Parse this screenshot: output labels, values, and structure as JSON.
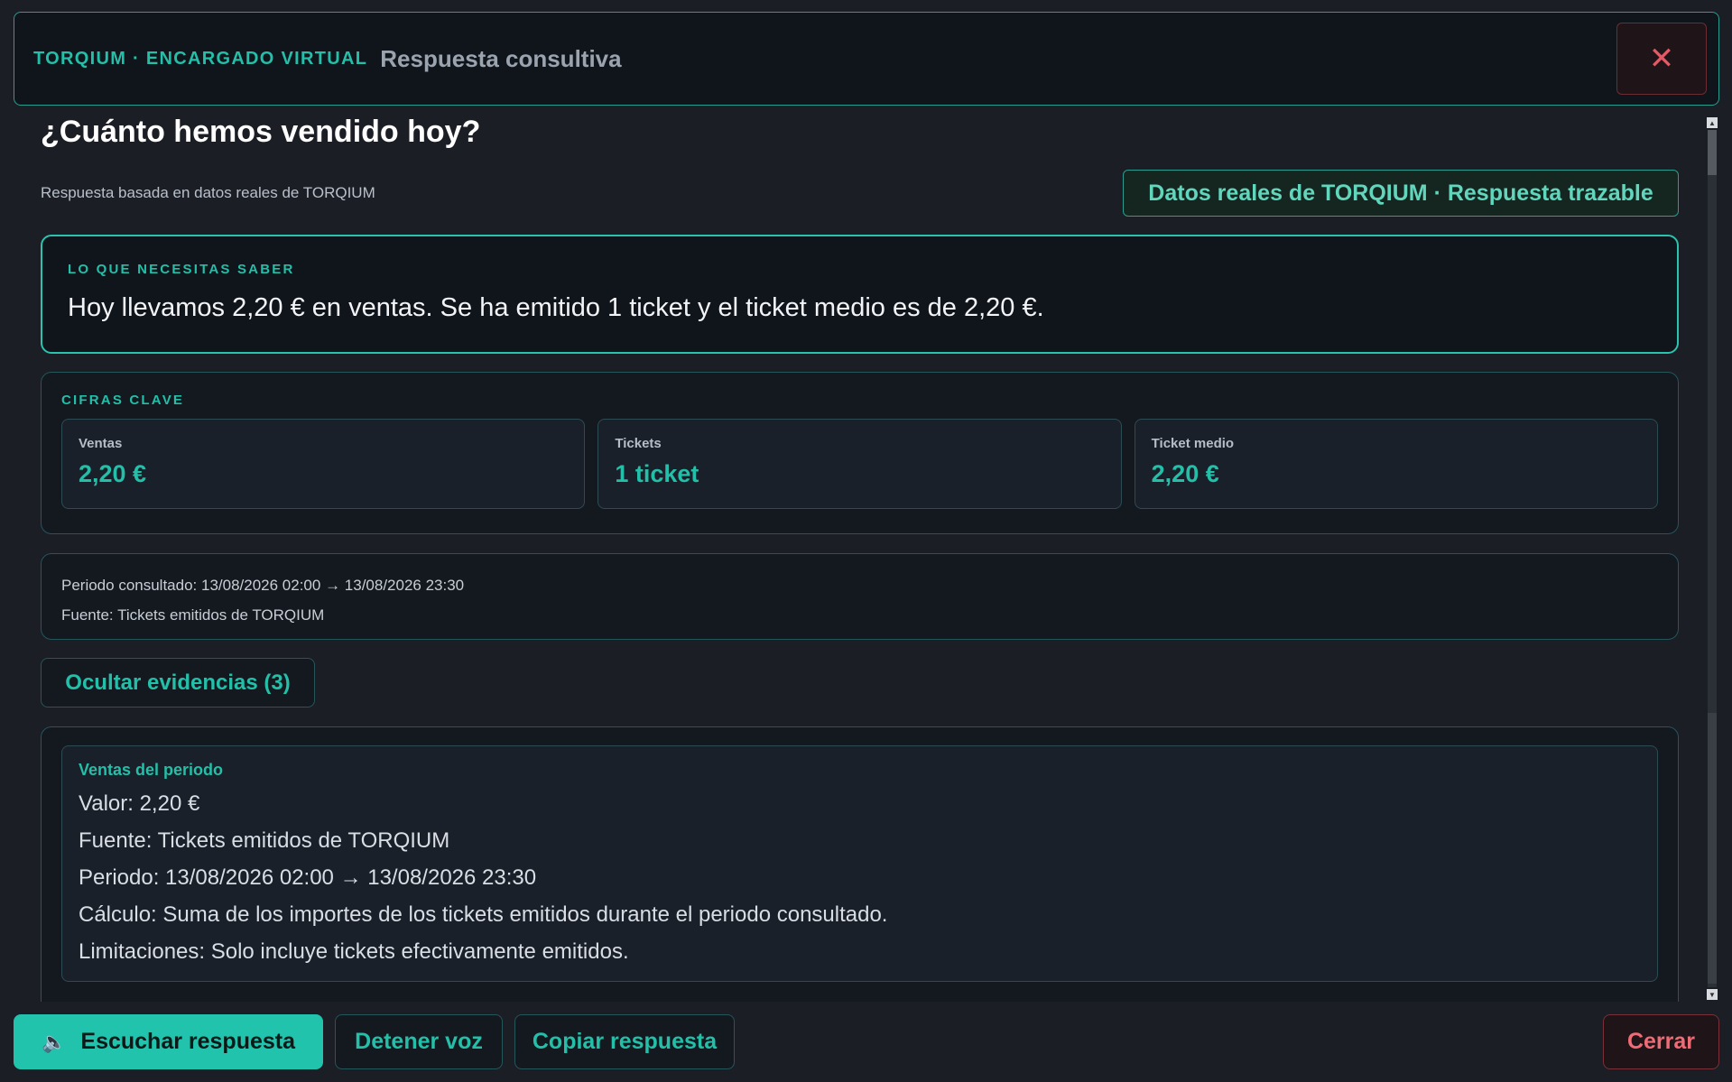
{
  "header": {
    "brand": "TORQIUM · ENCARGADO VIRTUAL",
    "subtitle": "Respuesta consultiva",
    "close_icon": "close-icon"
  },
  "main": {
    "question": "¿Cuánto hemos vendido hoy?",
    "based_on": "Respuesta basada en datos reales de TORQIUM",
    "badge": "Datos reales de TORQIUM · Respuesta trazable",
    "summary": {
      "label": "LO QUE NECESITAS SABER",
      "text": "Hoy llevamos 2,20 € en ventas. Se ha emitido 1 ticket y el ticket medio es de 2,20 €."
    },
    "kpis": {
      "label": "CIFRAS CLAVE",
      "items": [
        {
          "label": "Ventas",
          "value": "2,20 €"
        },
        {
          "label": "Tickets",
          "value": "1 ticket"
        },
        {
          "label": "Ticket medio",
          "value": "2,20 €"
        }
      ]
    },
    "period": {
      "consulted": "Periodo consultado: 13/08/2026 02:00 → 13/08/2026 23:30",
      "source": "Fuente: Tickets emitidos de TORQIUM"
    },
    "evidence_toggle": "Ocultar evidencias (3)",
    "evidence": [
      {
        "title": "Ventas del periodo",
        "value": "Valor: 2,20 €",
        "source": "Fuente: Tickets emitidos de TORQIUM",
        "period": "Periodo: 13/08/2026 02:00 → 13/08/2026 23:30",
        "calc": "Cálculo: Suma de los importes de los tickets emitidos durante el periodo consultado.",
        "limits": "Limitaciones: Solo incluye tickets efectivamente emitidos."
      }
    ]
  },
  "footer": {
    "listen": "Escuchar respuesta",
    "listen_icon": "speaker-icon",
    "stop": "Detener voz",
    "copy": "Copiar respuesta",
    "close": "Cerrar"
  },
  "colors": {
    "accent": "#23bfa8",
    "background": "#1b1e25",
    "danger": "#ef6b75"
  }
}
